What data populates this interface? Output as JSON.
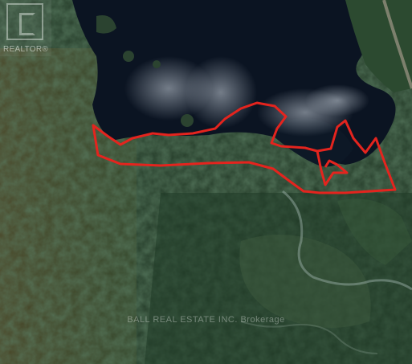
{
  "map": {
    "type": "satellite",
    "boundary_color": "#e4241e",
    "water_color": "#0b1422",
    "forest_color": "#243a28"
  },
  "logo": {
    "text": "REALTOR®",
    "icon": "realtor-r-logo"
  },
  "watermark": {
    "text": "BALL REAL ESTATE INC. Brokerage"
  }
}
